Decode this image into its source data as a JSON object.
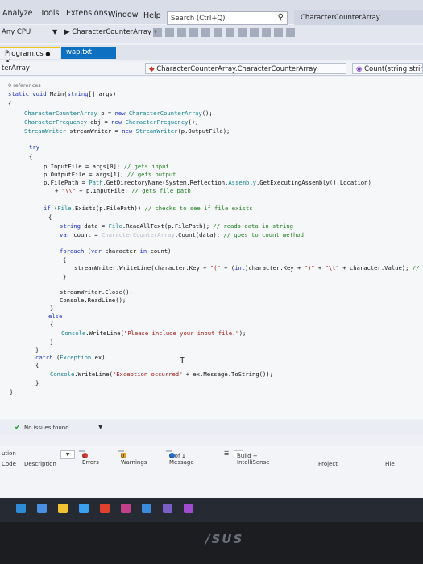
{
  "menu": {
    "items": [
      "Analyze",
      "Tools",
      "Extensions",
      "Window",
      "Help"
    ],
    "search_placeholder": "Search (Ctrl+Q)",
    "project_title": "CharacterCounterArray"
  },
  "toolbar": {
    "platform": "Any CPU",
    "run_target": "CharacterCounterArray"
  },
  "tabs": [
    {
      "label": "Program.cs",
      "active": true
    },
    {
      "label": "wap.txt",
      "active": false
    }
  ],
  "nav": {
    "left": "terArray",
    "middle": "CharacterCounterArray.CharacterCounterArray",
    "right": "Count(string string T"
  },
  "code": {
    "references": "0 references",
    "lines": [
      "static void Main(string[] args)",
      "{",
      "CharacterCounterArray p = new CharacterCounterArray();",
      "CharacterFrequency obj = new CharacterFrequency();",
      "StreamWriter streamWriter = new StreamWriter(p.OutputFile);",
      "try",
      "{",
      "p.InputFile = args[0]; // gets input",
      "p.OutputFile = args[1]; // gets output",
      "p.FilePath = Path.GetDirectoryName(System.Reflection.Assembly.GetExecutingAssembly().Location)",
      "+ \"\\\\\" + p.InputFile; // gets file path",
      "if (File.Exists(p.FilePath)) // checks to see if file exists",
      "{",
      "string data = File.ReadAllText(p.FilePath); // reads data in string",
      "var count = CharacterCounterArray.Count(data); // goes to count method",
      "foreach (var character in count)",
      "{",
      "streamWriter.WriteLine(character.Key + \"(\" + (int)character.Key + \")\" + \"\\t\" + character.Value); //",
      "}",
      "streamWriter.Close();",
      "Console.ReadLine();",
      "}",
      "else",
      "{",
      "Console.WriteLine(\"Please include your input file.\");",
      "}",
      "}",
      "catch (Exception ex)",
      "{",
      "Console.WriteLine(\"Exception occurred\" + ex.Message.ToString());",
      "}",
      "}"
    ]
  },
  "status": {
    "issues": "No issues found"
  },
  "error_list": {
    "scope_label": "ution",
    "errors": "0 Errors",
    "warnings": "0 Warnings",
    "messages": "0 of 1 Message",
    "build_filter": "Build + IntelliSense",
    "col_code": "Code",
    "col_description": "Description",
    "col_project": "Project",
    "col_file": "File"
  },
  "brand": "/SUS"
}
